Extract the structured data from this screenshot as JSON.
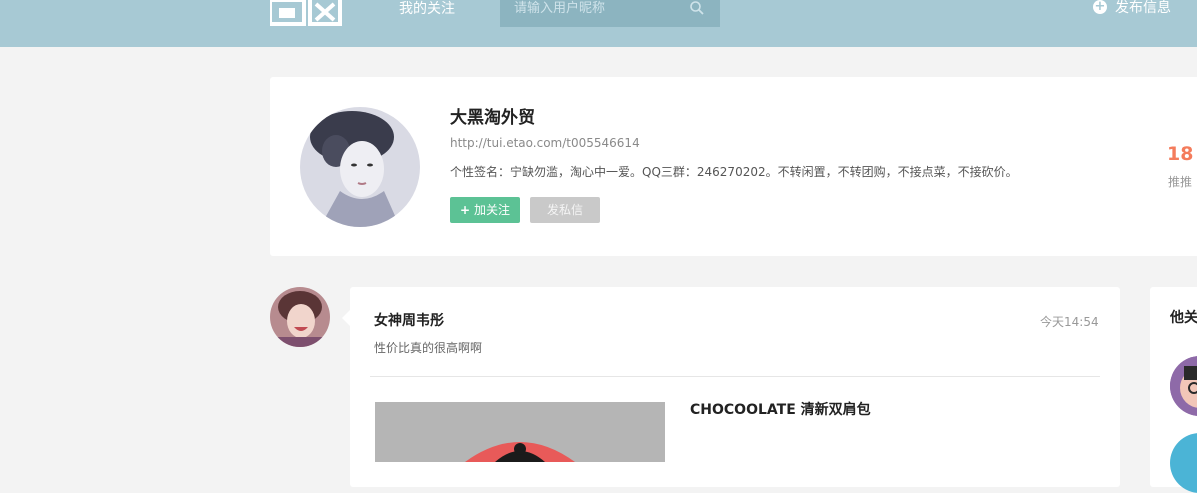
{
  "header": {
    "nav_follow": "我的关注",
    "search_placeholder": "请输入用户昵称",
    "publish_label": "发布信息"
  },
  "profile": {
    "name": "大黑淘外贸",
    "url": "http://tui.etao.com/t005546614",
    "signature": "个性签名：宁缺勿滥，淘心中一爱。QQ三群：246270202。不转闲置，不转团购，不接点菜，不接砍价。",
    "follow_button": "加关注",
    "message_button": "发私信",
    "stat_value": "18",
    "stat_label": "推推"
  },
  "post": {
    "author": "女神周韦彤",
    "time": "今天14:54",
    "text": "性价比真的很高啊啊",
    "product_title": "CHOCOOLATE 清新双肩包"
  },
  "sidebar": {
    "title": "他关"
  },
  "colors": {
    "topbar": "#a7c9d4",
    "follow_green": "#5cc295",
    "stat_orange": "#f47c5c"
  }
}
